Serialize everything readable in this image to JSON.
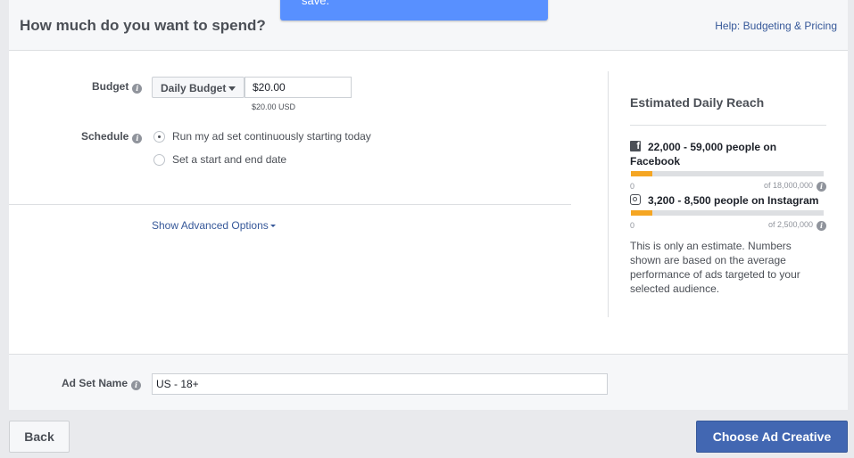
{
  "notification": {
    "text": "save."
  },
  "header": {
    "title": "How much do you want to spend?",
    "help_link": "Help: Budgeting & Pricing"
  },
  "budget": {
    "label": "Budget",
    "type_selected": "Daily Budget",
    "amount": "$20.00",
    "currency_note": "$20.00 USD"
  },
  "schedule": {
    "label": "Schedule",
    "options": [
      {
        "label": "Run my ad set continuously starting today",
        "selected": true
      },
      {
        "label": "Set a start and end date",
        "selected": false
      }
    ]
  },
  "advanced_link": "Show Advanced Options",
  "reach": {
    "title": "Estimated Daily Reach",
    "platforms": [
      {
        "icon": "facebook-icon",
        "text": "22,000 - 59,000 people on Facebook",
        "scale_min": "0",
        "scale_max": "of 18,000,000",
        "fill_fraction": 0.11
      },
      {
        "icon": "instagram-icon",
        "text": "3,200 - 8,500 people on Instagram",
        "scale_min": "0",
        "scale_max": "of 2,500,000",
        "fill_fraction": 0.11
      }
    ],
    "disclaimer": "This is only an estimate. Numbers shown are based on the average performance of ads targeted to your selected audience."
  },
  "ad_set_name": {
    "label": "Ad Set Name",
    "value": "US - 18+"
  },
  "footer": {
    "back_label": "Back",
    "primary_label": "Choose Ad Creative"
  },
  "colors": {
    "accent_blue": "#4267b2",
    "link_blue": "#365899",
    "notification_blue": "#5890ff",
    "reach_bar": "#f5a623"
  }
}
